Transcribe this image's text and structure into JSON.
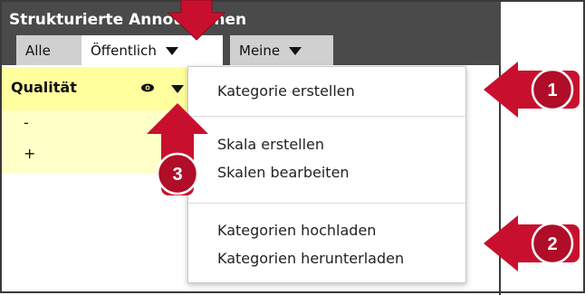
{
  "header": {
    "title": "Strukturierte Annotationen"
  },
  "tabs": [
    {
      "label": "Alle"
    },
    {
      "label": "Öffentlich"
    },
    {
      "label": "Meine"
    }
  ],
  "column": {
    "label": "Qualität",
    "rows": [
      "-",
      "+"
    ]
  },
  "menu": {
    "group1": [
      "Kategorie erstellen"
    ],
    "group2": [
      "Skala erstellen",
      "Skalen bearbeiten"
    ],
    "group3": [
      "Kategorien hochladen",
      "Kategorien herunterladen"
    ]
  },
  "callouts": [
    {
      "number": "1"
    },
    {
      "number": "2"
    },
    {
      "number": "3"
    }
  ],
  "colors": {
    "header_bg": "#4a4a4a",
    "column_header_bg": "#ffff9e",
    "row_bg": "#ffffc8",
    "callout_red": "#c8102e"
  }
}
